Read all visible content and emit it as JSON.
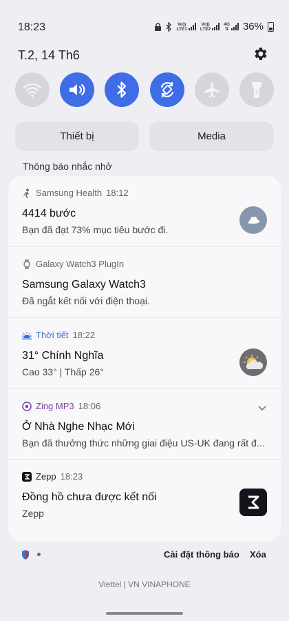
{
  "status_bar": {
    "time": "18:23",
    "sim1_label_top": "Vo))",
    "sim1_label_bottom": "LTE1",
    "sim2_label_top": "Vo))",
    "sim2_label_bottom": "LTE2",
    "network_type": "4G",
    "battery_percent": "36%"
  },
  "header": {
    "date": "T.2, 14 Th6"
  },
  "quick_settings": [
    {
      "icon": "wifi-icon",
      "state": "off"
    },
    {
      "icon": "sound-icon",
      "state": "on"
    },
    {
      "icon": "bluetooth-icon",
      "state": "on"
    },
    {
      "icon": "auto-rotate-icon",
      "state": "on"
    },
    {
      "icon": "airplane-icon",
      "state": "off"
    },
    {
      "icon": "flashlight-icon",
      "state": "off"
    }
  ],
  "segments": {
    "devices": "Thiết bị",
    "media": "Media"
  },
  "section_label": "Thông báo nhắc nhở",
  "notifications": [
    {
      "app": "Samsung Health",
      "time": "18:12",
      "title": "4414 bước",
      "body": "Bạn đã đạt 73% mục tiêu bước đi."
    },
    {
      "app": "Galaxy Watch3 PlugIn",
      "time": "",
      "title": "Samsung Galaxy Watch3",
      "body": "Đã ngắt kết nối với điện thoại."
    },
    {
      "app": "Thời tiết",
      "time": "18:22",
      "title": "31° Chính Nghĩa",
      "body": "Cao 33° | Thấp 26°"
    },
    {
      "app": "Zing MP3",
      "time": "18:06",
      "title": "Ở Nhà Nghe Nhạc Mới",
      "body": "Bạn đã thưởng thức những giai điệu US-UK đang rất đ..."
    },
    {
      "app": "Zepp",
      "time": "18:23",
      "title": "Đồng hồ chưa được kết nối",
      "body": "Zepp"
    }
  ],
  "footer": {
    "settings": "Cài đặt thông báo",
    "clear": "Xóa"
  },
  "carrier": "Viettel | VN VINAPHONE",
  "colors": {
    "accent": "#3e6de6",
    "weather": "#3a6fd8",
    "zing": "#7b3fa0"
  }
}
